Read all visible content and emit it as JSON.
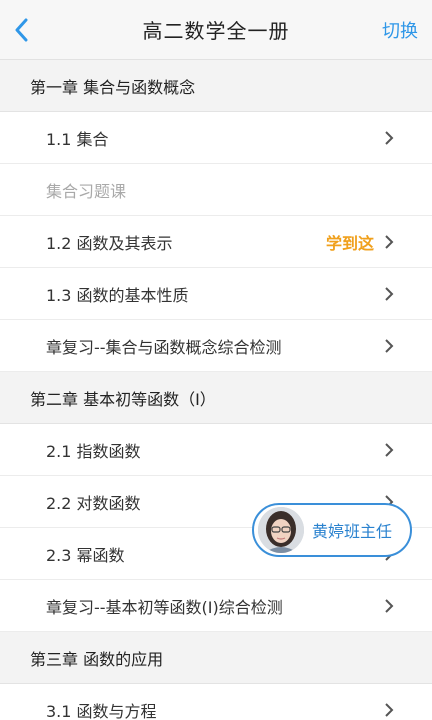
{
  "header": {
    "title": "高二数学全一册",
    "switch_label": "切换",
    "back_icon": "chevron-left-icon"
  },
  "chapters": [
    {
      "title": "第一章 集合与函数概念",
      "items": [
        {
          "label": "1.1 集合",
          "progress": ""
        },
        {
          "label": "集合习题课",
          "progress": ""
        },
        {
          "label": "1.2 函数及其表示",
          "progress": "学到这"
        },
        {
          "label": "1.3 函数的基本性质",
          "progress": ""
        },
        {
          "label": "章复习--集合与函数概念综合检测",
          "progress": ""
        }
      ]
    },
    {
      "title": "第二章 基本初等函数（Ⅰ）",
      "items": [
        {
          "label": "2.1 指数函数",
          "progress": ""
        },
        {
          "label": "2.2 对数函数",
          "progress": ""
        },
        {
          "label": "2.3 幂函数",
          "progress": ""
        },
        {
          "label": "章复习--基本初等函数(Ⅰ)综合检测",
          "progress": ""
        }
      ]
    },
    {
      "title": "第三章 函数的应用",
      "items": [
        {
          "label": "3.1 函数与方程",
          "progress": ""
        }
      ]
    }
  ],
  "teacher": {
    "name": "黄婷班主任"
  },
  "colors": {
    "accent_blue": "#2f97e8",
    "progress_orange": "#f0a01c",
    "muted_text": "#a9a9a9"
  }
}
